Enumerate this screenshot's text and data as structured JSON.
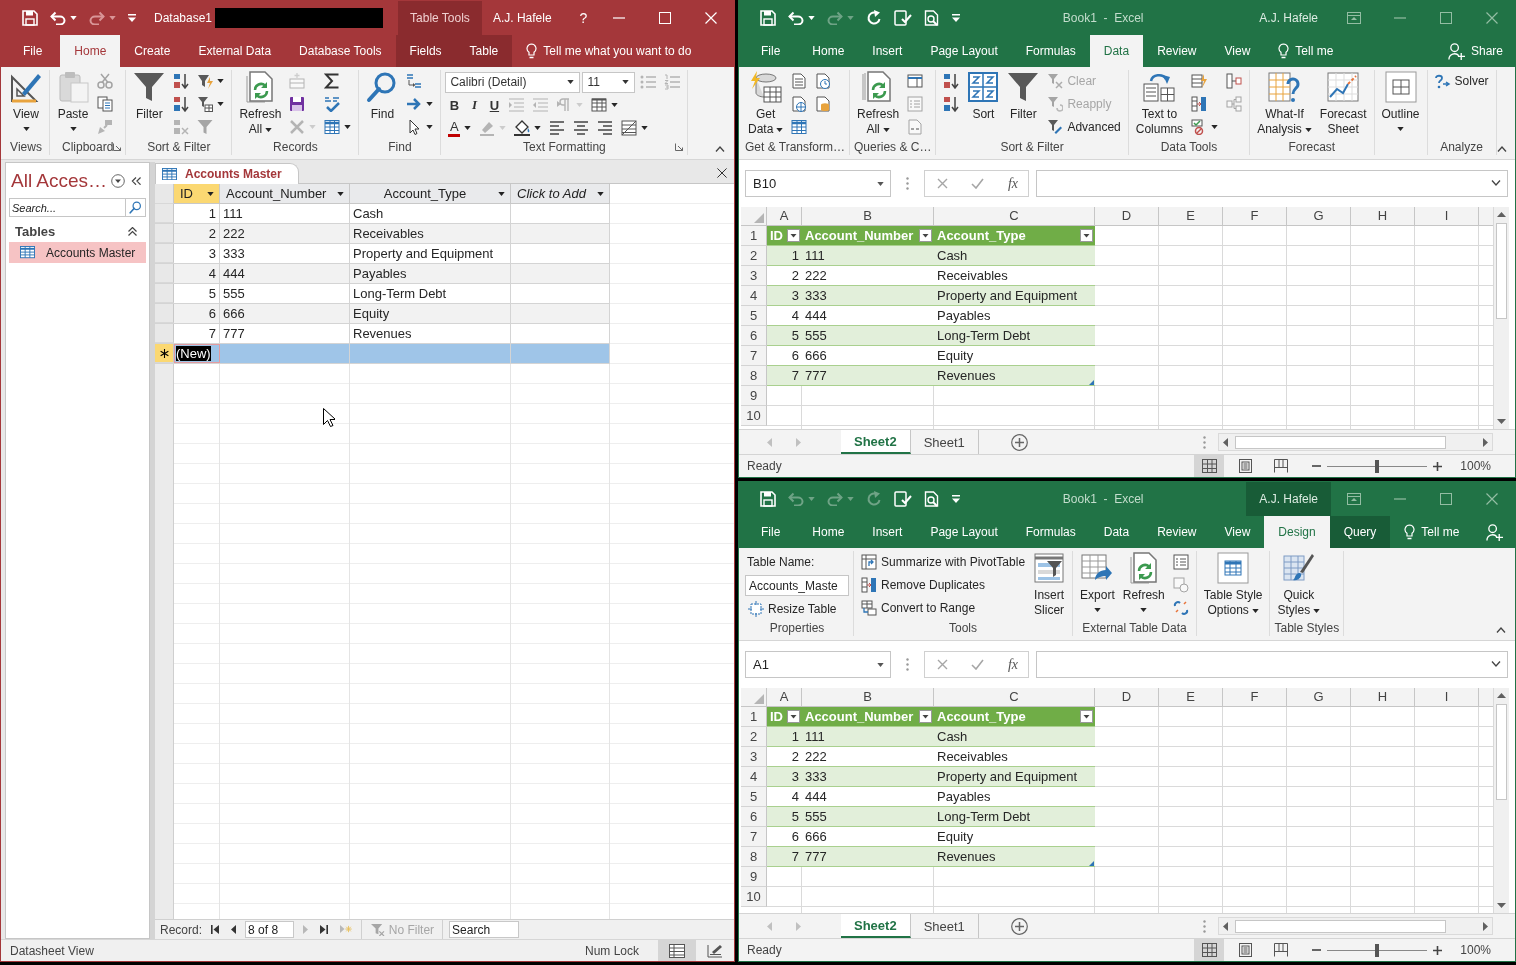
{
  "access": {
    "active": true,
    "quick_access": [
      {
        "disabled": false
      },
      {
        "disabled": false
      },
      {
        "disabled": true
      }
    ],
    "title": "Database1",
    "context_label": "Table Tools",
    "user": "A.J. Hafele",
    "help": "?",
    "tabs": [
      {
        "label": "File",
        "kind": "file",
        "selected": false
      },
      {
        "label": "Home",
        "kind": "main",
        "selected": true
      },
      {
        "label": "Create",
        "kind": "main",
        "selected": false
      },
      {
        "label": "External Data",
        "kind": "main",
        "selected": false
      },
      {
        "label": "Database Tools",
        "kind": "main",
        "selected": false
      },
      {
        "label": "Fields",
        "kind": "contextual",
        "selected": false
      },
      {
        "label": "Table",
        "kind": "contextual",
        "selected": false
      }
    ],
    "tell_me": "Tell me what you want to do",
    "ribbon": [
      {
        "label": "Views",
        "items": [
          {
            "kind": "large",
            "label": "View",
            "dropdown": true,
            "disabled": false
          }
        ]
      },
      {
        "label": "Clipboard",
        "launcher": true,
        "items": [
          {
            "kind": "large",
            "label": "Paste",
            "dropdown": true,
            "disabled": false
          },
          {
            "kind": "stack",
            "buttons": [
              {
                "kind": "button",
                "dropdown": false,
                "disabled": true
              },
              {
                "kind": "button",
                "dropdown": false,
                "disabled": false
              },
              {
                "kind": "button",
                "dropdown": false,
                "disabled": true
              }
            ]
          }
        ]
      },
      {
        "label": "Sort & Filter",
        "items": [
          {
            "kind": "large",
            "label": "Filter",
            "dropdown": false,
            "disabled": false
          },
          {
            "kind": "stack",
            "buttons": [
              {
                "kind": "button",
                "dropdown": false,
                "disabled": false
              },
              {
                "kind": "button",
                "dropdown": false,
                "disabled": false
              },
              {
                "kind": "button",
                "dropdown": false,
                "disabled": true
              }
            ]
          },
          {
            "kind": "stack",
            "buttons": [
              {
                "kind": "button",
                "dropdown": true,
                "disabled": false
              },
              {
                "kind": "button",
                "dropdown": true,
                "disabled": false
              },
              {
                "kind": "button",
                "dropdown": false,
                "disabled": true
              }
            ]
          }
        ]
      },
      {
        "label": "Records",
        "items": [
          {
            "kind": "large",
            "label": "Refresh All",
            "dropdown": true,
            "disabled": false
          },
          {
            "kind": "stack",
            "buttons": [
              {
                "kind": "button",
                "dropdown": false,
                "disabled": true
              },
              {
                "kind": "button",
                "dropdown": false,
                "disabled": false
              },
              {
                "kind": "button",
                "dropdown": true,
                "disabled": true
              }
            ]
          },
          {
            "kind": "stack",
            "buttons": [
              {
                "kind": "button",
                "dropdown": false,
                "disabled": false
              },
              {
                "kind": "button",
                "dropdown": false,
                "disabled": false
              },
              {
                "kind": "button",
                "dropdown": true,
                "disabled": false
              }
            ]
          }
        ]
      },
      {
        "label": "Find",
        "items": [
          {
            "kind": "large",
            "label": "Find",
            "dropdown": false,
            "disabled": false
          },
          {
            "kind": "stack",
            "buttons": [
              {
                "kind": "button",
                "dropdown": false,
                "disabled": false
              },
              {
                "kind": "button",
                "dropdown": true,
                "disabled": false
              },
              {
                "kind": "button",
                "dropdown": true,
                "disabled": false
              }
            ]
          }
        ]
      },
      {
        "label": "Text Formatting",
        "launcher": true,
        "items": [
          {
            "kind": "rows",
            "rows": [
              [
                {
                  "kind": "combo",
                  "value": "Calibri (Detail)"
                },
                {
                  "kind": "combo",
                  "value": "11"
                },
                {
                  "kind": "button",
                  "dropdown": false,
                  "disabled": true
                },
                {
                  "kind": "button",
                  "dropdown": false,
                  "disabled": true
                }
              ],
              [
                {
                  "kind": "button",
                  "label": "B",
                  "dropdown": false,
                  "disabled": false
                },
                {
                  "kind": "button",
                  "label": "I",
                  "dropdown": false,
                  "disabled": false
                },
                {
                  "kind": "button",
                  "label": "U",
                  "dropdown": false,
                  "disabled": false
                },
                {
                  "kind": "button",
                  "dropdown": false,
                  "disabled": true
                },
                {
                  "kind": "button",
                  "dropdown": false,
                  "disabled": true
                },
                {
                  "kind": "button",
                  "dropdown": true,
                  "disabled": true
                },
                {
                  "kind": "button",
                  "dropdown": true,
                  "disabled": false
                }
              ],
              [
                {
                  "kind": "button",
                  "label": "A",
                  "dropdown": true,
                  "disabled": false
                },
                {
                  "kind": "button",
                  "dropdown": true,
                  "disabled": true
                },
                {
                  "kind": "button",
                  "dropdown": true,
                  "disabled": false
                },
                {
                  "kind": "button",
                  "dropdown": false,
                  "disabled": false
                },
                {
                  "kind": "button",
                  "dropdown": false,
                  "disabled": false
                },
                {
                  "kind": "button",
                  "dropdown": false,
                  "disabled": false
                },
                {
                  "kind": "button",
                  "dropdown": true,
                  "disabled": false
                }
              ]
            ]
          }
        ]
      }
    ],
    "nav_pane": {
      "title": "All Acces…",
      "search": {
        "placeholder": "Search..."
      },
      "groups": [
        {
          "label": "Tables",
          "expanded": true,
          "items": [
            {
              "label": "Accounts Master",
              "selected": true
            }
          ]
        }
      ]
    },
    "document_tab": {
      "label": "Accounts Master"
    },
    "datasheet": {
      "columns": [
        {
          "label": "ID",
          "kind": "field",
          "selected": true
        },
        {
          "label": "Account_Number",
          "kind": "field",
          "selected": false
        },
        {
          "label": "Account_Type",
          "kind": "field",
          "selected": false
        },
        {
          "label": "Click to Add",
          "kind": "add",
          "selected": false
        }
      ],
      "rows": [
        {
          "cells": [
            "1",
            "111",
            "Cash"
          ],
          "selected": false
        },
        {
          "cells": [
            "2",
            "222",
            "Receivables"
          ],
          "selected": false
        },
        {
          "cells": [
            "3",
            "333",
            "Property and Equipment"
          ],
          "selected": false
        },
        {
          "cells": [
            "4",
            "444",
            "Payables"
          ],
          "selected": false
        },
        {
          "cells": [
            "5",
            "555",
            "Long-Term Debt"
          ],
          "selected": false
        },
        {
          "cells": [
            "6",
            "666",
            "Equity"
          ],
          "selected": false
        },
        {
          "cells": [
            "7",
            "777",
            "Revenues"
          ],
          "selected": false
        }
      ],
      "new_row": {
        "label": "(New)",
        "selected": true
      }
    },
    "record_navigator": {
      "label": "Record:",
      "buttons": [
        {
          "disabled": false
        },
        {
          "disabled": false
        },
        {
          "disabled": true
        },
        {
          "disabled": false
        },
        {
          "disabled": true
        }
      ],
      "position": "8 of 8",
      "filter": {
        "label": "No Filter",
        "disabled": true
      },
      "search": {
        "placeholder": "Search"
      }
    },
    "status_bar": {
      "text": "Datasheet View",
      "indicator": "Num Lock",
      "views": [
        {
          "selected": true
        },
        {
          "selected": false
        }
      ]
    }
  },
  "excel_top": {
    "active": false,
    "quick_access": [
      {
        "disabled": false
      },
      {
        "disabled": false
      },
      {
        "disabled": true
      },
      {
        "disabled": false
      },
      {
        "disabled": false
      },
      {
        "disabled": false
      }
    ],
    "title": "Book1  -  Excel",
    "contextual_header": false,
    "user": "A.J. Hafele",
    "tabs": [
      {
        "label": "File",
        "kind": "file",
        "selected": false
      },
      {
        "label": "Home",
        "kind": "main",
        "selected": false
      },
      {
        "label": "Insert",
        "kind": "main",
        "selected": false
      },
      {
        "label": "Page Layout",
        "kind": "main",
        "selected": false
      },
      {
        "label": "Formulas",
        "kind": "main",
        "selected": false
      },
      {
        "label": "Data",
        "kind": "main",
        "selected": true
      },
      {
        "label": "Review",
        "kind": "main",
        "selected": false
      },
      {
        "label": "View",
        "kind": "main",
        "selected": false
      }
    ],
    "tell_me": "Tell me",
    "share": "Share",
    "ribbon": [
      {
        "label": "Get & Transform…",
        "items": [
          {
            "kind": "large",
            "label": "Get Data",
            "dropdown": true,
            "disabled": false
          },
          {
            "kind": "stack",
            "buttons": [
              {
                "kind": "button",
                "dropdown": false,
                "disabled": false
              },
              {
                "kind": "button",
                "dropdown": false,
                "disabled": false
              },
              {
                "kind": "button",
                "dropdown": false,
                "disabled": false
              }
            ]
          },
          {
            "kind": "stack",
            "buttons": [
              {
                "kind": "button",
                "dropdown": false,
                "disabled": false
              },
              {
                "kind": "button",
                "dropdown": false,
                "disabled": false
              }
            ]
          }
        ]
      },
      {
        "label": "Queries & C…",
        "items": [
          {
            "kind": "large",
            "label": "Refresh All",
            "dropdown": true,
            "disabled": false
          },
          {
            "kind": "stack",
            "buttons": [
              {
                "kind": "button",
                "dropdown": false,
                "disabled": false
              },
              {
                "kind": "button",
                "dropdown": false,
                "disabled": true
              },
              {
                "kind": "button",
                "dropdown": false,
                "disabled": true
              }
            ]
          }
        ]
      },
      {
        "label": "Sort & Filter",
        "items": [
          {
            "kind": "stack",
            "buttons": [
              {
                "kind": "button",
                "dropdown": false,
                "disabled": false
              },
              {
                "kind": "button",
                "dropdown": false,
                "disabled": false
              }
            ]
          },
          {
            "kind": "large",
            "label": "Sort",
            "dropdown": false,
            "disabled": false
          },
          {
            "kind": "large",
            "label": "Filter",
            "dropdown": false,
            "disabled": false
          },
          {
            "kind": "stack",
            "buttons": [
              {
                "kind": "button",
                "label": "Clear",
                "dropdown": false,
                "disabled": true
              },
              {
                "kind": "button",
                "label": "Reapply",
                "dropdown": false,
                "disabled": true
              },
              {
                "kind": "button",
                "label": "Advanced",
                "dropdown": false,
                "disabled": false
              }
            ]
          }
        ]
      },
      {
        "label": "Data Tools",
        "items": [
          {
            "kind": "large",
            "label": "Text to Columns",
            "dropdown": false,
            "disabled": false
          },
          {
            "kind": "stack",
            "buttons": [
              {
                "kind": "button",
                "dropdown": false,
                "disabled": false
              },
              {
                "kind": "button",
                "dropdown": false,
                "disabled": false
              },
              {
                "kind": "button",
                "dropdown": true,
                "disabled": false
              }
            ]
          },
          {
            "kind": "stack",
            "buttons": [
              {
                "kind": "button",
                "dropdown": false,
                "disabled": false
              },
              {
                "kind": "button",
                "dropdown": false,
                "disabled": true
              }
            ]
          }
        ]
      },
      {
        "label": "Forecast",
        "items": [
          {
            "kind": "large",
            "label": "What-If Analysis",
            "dropdown": true,
            "disabled": false
          },
          {
            "kind": "large",
            "label": "Forecast Sheet",
            "dropdown": false,
            "disabled": false
          }
        ]
      },
      {
        "items": [
          {
            "kind": "large",
            "label": "Outline",
            "dropdown": true,
            "disabled": false
          }
        ]
      },
      {
        "label": "Analyze",
        "items": [
          {
            "kind": "stack",
            "buttons": [
              {
                "kind": "button",
                "label": "Solver",
                "dropdown": false,
                "disabled": false
              }
            ]
          }
        ]
      }
    ],
    "formula_bar": {
      "name_box": "B10",
      "function_label": "fx"
    },
    "sheet": {
      "columns": [
        "A",
        "B",
        "C",
        "D",
        "E",
        "F",
        "G",
        "H",
        "I"
      ],
      "rows": [
        "1",
        "2",
        "3",
        "4",
        "5",
        "6",
        "7",
        "8",
        "9",
        "10"
      ],
      "table": {
        "headers": [
          "ID",
          "Account_Number",
          "Account_Type"
        ],
        "rows": [
          [
            "1",
            "111",
            "Cash"
          ],
          [
            "2",
            "222",
            "Receivables"
          ],
          [
            "3",
            "333",
            "Property and Equipment"
          ],
          [
            "4",
            "444",
            "Payables"
          ],
          [
            "5",
            "555",
            "Long-Term Debt"
          ],
          [
            "6",
            "666",
            "Equity"
          ],
          [
            "7",
            "777",
            "Revenues"
          ]
        ]
      }
    },
    "sheet_tabs": [
      {
        "label": "Sheet2",
        "selected": true
      },
      {
        "label": "Sheet1",
        "selected": false
      }
    ],
    "status": "Ready",
    "views": [
      {
        "selected": true
      },
      {
        "selected": false
      },
      {
        "selected": false
      }
    ],
    "zoom": {
      "level": 0.5,
      "reading": "100%"
    }
  },
  "excel_bottom": {
    "active": false,
    "quick_access": [
      {
        "disabled": false
      },
      {
        "disabled": true
      },
      {
        "disabled": true
      },
      {
        "disabled": true
      },
      {
        "disabled": false
      },
      {
        "disabled": false
      }
    ],
    "title": "Book1  -  Excel",
    "contextual_header": true,
    "user": "A.J. Hafele",
    "tabs": [
      {
        "label": "File",
        "kind": "file",
        "selected": false
      },
      {
        "label": "Home",
        "kind": "main",
        "selected": false
      },
      {
        "label": "Insert",
        "kind": "main",
        "selected": false
      },
      {
        "label": "Page Layout",
        "kind": "main",
        "selected": false
      },
      {
        "label": "Formulas",
        "kind": "main",
        "selected": false
      },
      {
        "label": "Data",
        "kind": "main",
        "selected": false
      },
      {
        "label": "Review",
        "kind": "main",
        "selected": false
      },
      {
        "label": "View",
        "kind": "main",
        "selected": false
      },
      {
        "label": "Design",
        "kind": "contextual",
        "selected": true
      },
      {
        "label": "Query",
        "kind": "contextual",
        "selected": false
      }
    ],
    "tell_me": "Tell me",
    "ribbon": [
      {
        "label": "Properties",
        "items": [
          {
            "kind": "stack",
            "buttons": [
              {
                "kind": "text",
                "label": "Table Name:"
              },
              {
                "kind": "input",
                "value": "Accounts_Maste"
              },
              {
                "kind": "button",
                "label": "Resize Table",
                "dropdown": false,
                "disabled": false
              }
            ]
          }
        ]
      },
      {
        "label": "Tools",
        "items": [
          {
            "kind": "stack",
            "buttons": [
              {
                "kind": "button",
                "label": "Summarize with PivotTable",
                "dropdown": false,
                "disabled": false
              },
              {
                "kind": "button",
                "label": "Remove Duplicates",
                "dropdown": false,
                "disabled": false
              },
              {
                "kind": "button",
                "label": "Convert to Range",
                "dropdown": false,
                "disabled": false
              }
            ]
          },
          {
            "kind": "large",
            "label": "Insert Slicer",
            "dropdown": false,
            "disabled": false
          }
        ]
      },
      {
        "label": "External Table Data",
        "items": [
          {
            "kind": "large",
            "label": "Export",
            "dropdown": true,
            "disabled": false
          },
          {
            "kind": "large",
            "label": "Refresh",
            "dropdown": true,
            "disabled": false
          },
          {
            "kind": "stack",
            "buttons": [
              {
                "kind": "button",
                "dropdown": false,
                "disabled": false
              },
              {
                "kind": "button",
                "dropdown": false,
                "disabled": true
              },
              {
                "kind": "button",
                "dropdown": false,
                "disabled": false
              }
            ]
          }
        ]
      },
      {
        "items": [
          {
            "kind": "large",
            "label": "Table Style Options",
            "dropdown": true,
            "disabled": false
          }
        ]
      },
      {
        "label": "Table Styles",
        "items": [
          {
            "kind": "large",
            "label": "Quick Styles",
            "dropdown": true,
            "disabled": false
          }
        ]
      }
    ],
    "formula_bar": {
      "name_box": "A1",
      "function_label": "fx"
    },
    "sheet": {
      "columns": [
        "A",
        "B",
        "C",
        "D",
        "E",
        "F",
        "G",
        "H",
        "I"
      ],
      "rows": [
        "1",
        "2",
        "3",
        "4",
        "5",
        "6",
        "7",
        "8",
        "9",
        "10"
      ],
      "table": {
        "headers": [
          "ID",
          "Account_Number",
          "Account_Type"
        ],
        "rows": [
          [
            "1",
            "111",
            "Cash"
          ],
          [
            "2",
            "222",
            "Receivables"
          ],
          [
            "3",
            "333",
            "Property and Equipment"
          ],
          [
            "4",
            "444",
            "Payables"
          ],
          [
            "5",
            "555",
            "Long-Term Debt"
          ],
          [
            "6",
            "666",
            "Equity"
          ],
          [
            "7",
            "777",
            "Revenues"
          ]
        ]
      }
    },
    "sheet_tabs": [
      {
        "label": "Sheet2",
        "selected": true
      },
      {
        "label": "Sheet1",
        "selected": false
      }
    ],
    "status": "Ready",
    "views": [
      {
        "selected": true
      },
      {
        "selected": false
      },
      {
        "selected": false
      }
    ],
    "zoom": {
      "level": 0.5,
      "reading": "100%"
    }
  }
}
